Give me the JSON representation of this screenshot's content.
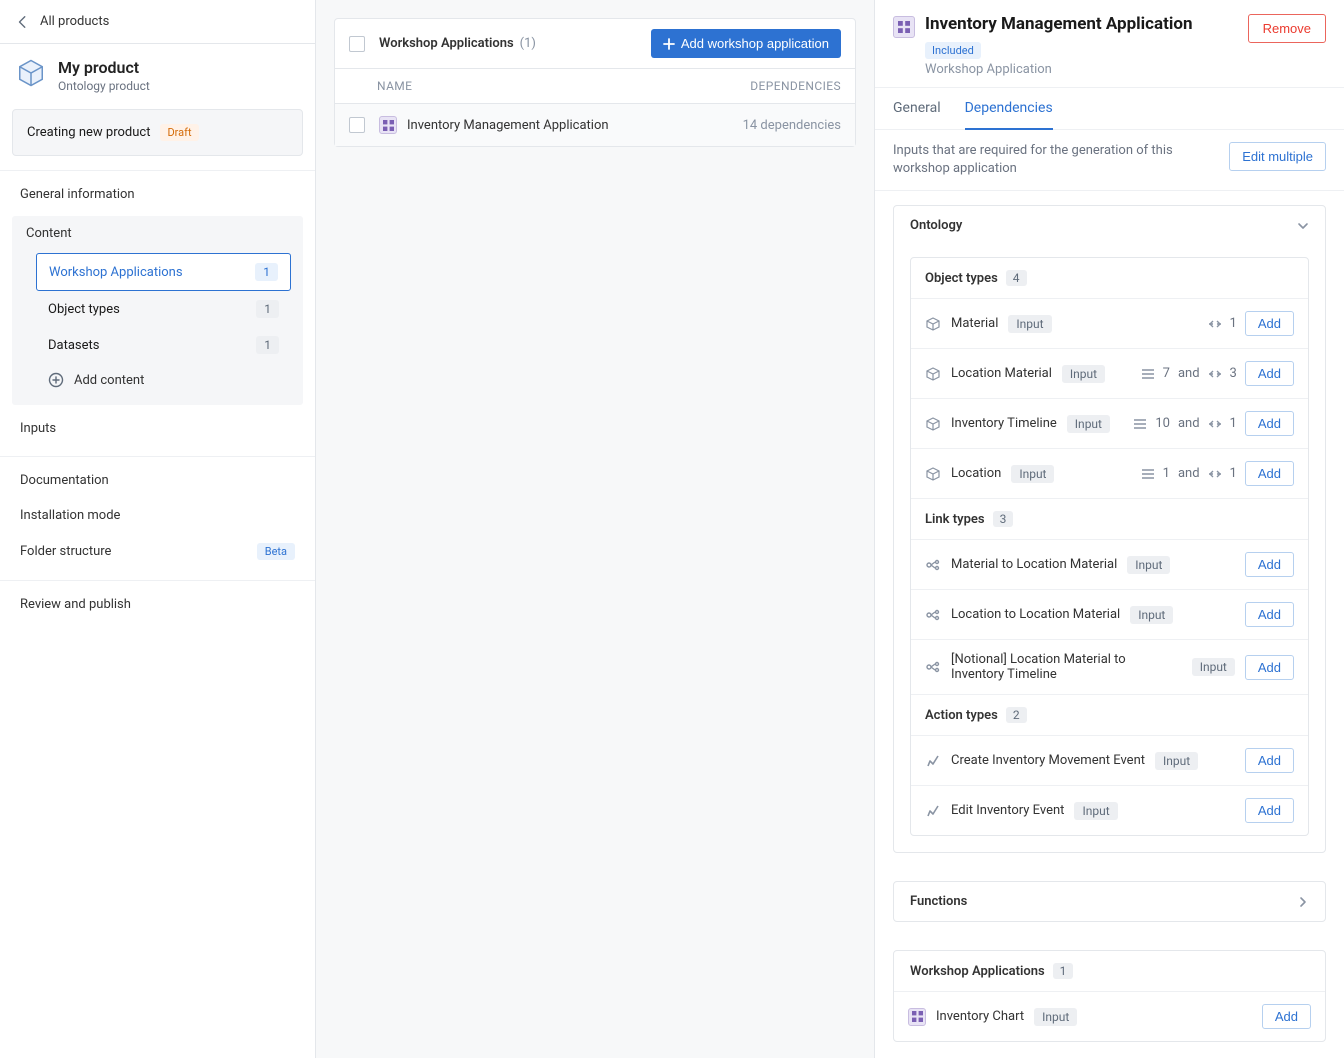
{
  "sidebar": {
    "back_label": "All products",
    "product_name": "My product",
    "product_sub": "Ontology product",
    "creating_label": "Creating new product",
    "draft_badge": "Draft",
    "nav": {
      "general_info": "General information",
      "content": "Content",
      "inputs": "Inputs",
      "documentation": "Documentation",
      "installation_mode": "Installation mode",
      "folder_structure": "Folder structure",
      "review": "Review and publish",
      "beta_badge": "Beta",
      "add_content": "Add content"
    },
    "content_items": {
      "workshop_apps": {
        "label": "Workshop Applications",
        "count": "1"
      },
      "object_types": {
        "label": "Object types",
        "count": "1"
      },
      "datasets": {
        "label": "Datasets",
        "count": "1"
      }
    }
  },
  "middle": {
    "list_title": "Workshop Applications",
    "list_count": "(1)",
    "add_button": "Add workshop application",
    "col_name": "NAME",
    "col_deps": "DEPENDENCIES",
    "rows": [
      {
        "name": "Inventory Management Application",
        "deps": "14 dependencies"
      }
    ]
  },
  "right": {
    "title": "Inventory Management Application",
    "included_badge": "Included",
    "subtitle": "Workshop Application",
    "remove_btn": "Remove",
    "tabs": {
      "general": "General",
      "dependencies": "Dependencies"
    },
    "deps_description": "Inputs that are required for the generation of this workshop application",
    "edit_multiple": "Edit multiple",
    "ontology_title": "Ontology",
    "object_types_title": "Object types",
    "object_types_count": "4",
    "and_text": "and",
    "input_badge": "Input",
    "add_btn": "Add",
    "object_types": [
      {
        "name": "Material",
        "props": null,
        "links": "1"
      },
      {
        "name": "Location Material",
        "props": "7",
        "links": "3"
      },
      {
        "name": "Inventory Timeline",
        "props": "10",
        "links": "1"
      },
      {
        "name": "Location",
        "props": "1",
        "links": "1"
      }
    ],
    "link_types_title": "Link types",
    "link_types_count": "3",
    "link_types": [
      {
        "name": "Material to Location Material"
      },
      {
        "name": "Location to Location Material"
      },
      {
        "name": "[Notional] Location Material to Inventory Timeline"
      }
    ],
    "action_types_title": "Action types",
    "action_types_count": "2",
    "action_types": [
      {
        "name": "Create Inventory Movement Event"
      },
      {
        "name": "Edit Inventory Event"
      }
    ],
    "functions_title": "Functions",
    "workshop_apps_title": "Workshop Applications",
    "workshop_apps_count": "1",
    "workshop_apps": [
      {
        "name": "Inventory Chart"
      }
    ]
  }
}
